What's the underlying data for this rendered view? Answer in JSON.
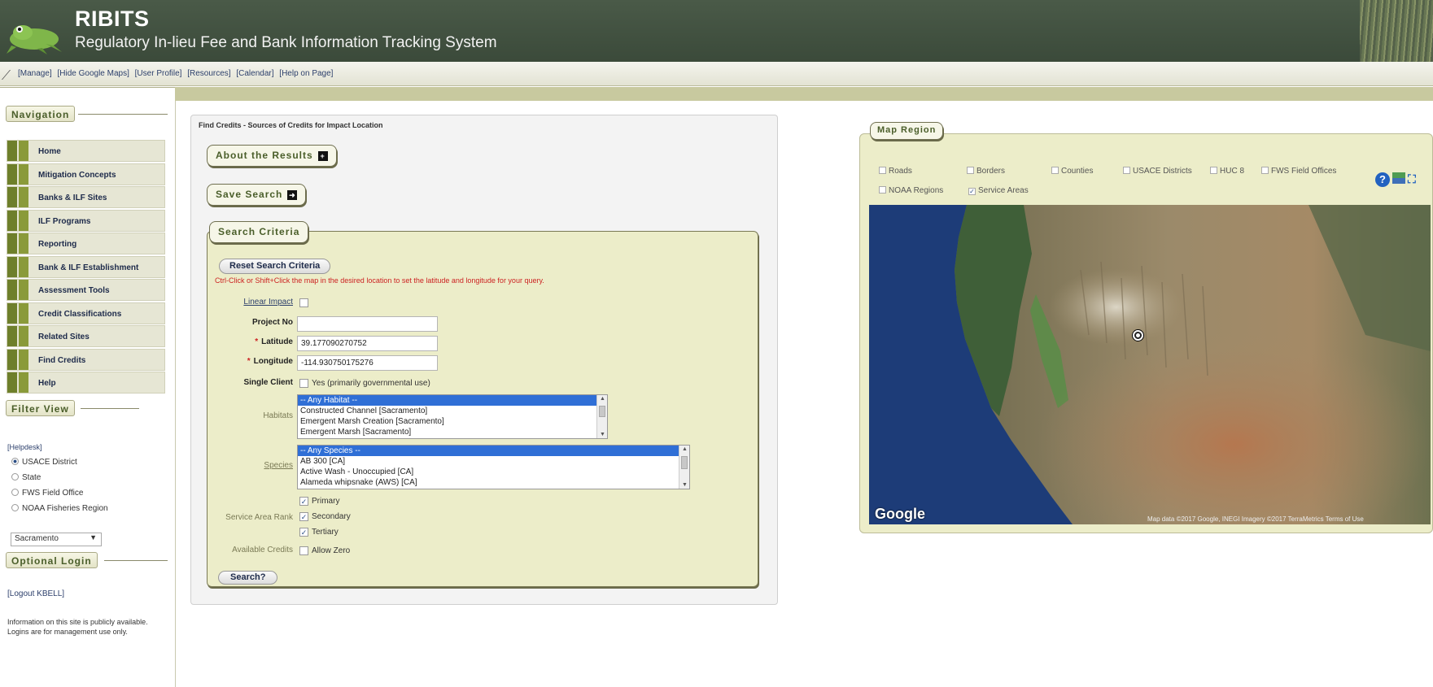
{
  "header": {
    "title": "RIBITS",
    "subtitle": "Regulatory In-lieu Fee and Bank Information Tracking System"
  },
  "menubar": {
    "links": [
      "[Manage]",
      "[Hide Google Maps]",
      "[User Profile]",
      "[Resources]",
      "[Calendar]",
      "[Help on Page]"
    ]
  },
  "sidebar": {
    "navigation_title": "Navigation",
    "items": [
      {
        "label": "Home"
      },
      {
        "label": "Mitigation Concepts"
      },
      {
        "label": "Banks & ILF Sites"
      },
      {
        "label": "ILF Programs"
      },
      {
        "label": "Reporting"
      },
      {
        "label": "Bank & ILF Establishment"
      },
      {
        "label": "Assessment Tools"
      },
      {
        "label": "Credit Classifications"
      },
      {
        "label": "Related Sites"
      },
      {
        "label": "Find Credits"
      },
      {
        "label": "Help"
      }
    ],
    "filter_title": "Filter View",
    "filter_help": "[Helpdesk]",
    "filter_options": [
      {
        "label": "USACE District",
        "selected": true
      },
      {
        "label": "State",
        "selected": false
      },
      {
        "label": "FWS Field Office",
        "selected": false
      },
      {
        "label": "NOAA Fisheries Region",
        "selected": false
      }
    ],
    "district_value": "Sacramento",
    "login_title": "Optional Login",
    "logout": "[Logout KBELL]",
    "info": "Information on this site is publicly available. Logins are for management use only."
  },
  "find_credits": {
    "panel_title": "Find Credits - Sources of Credits for Impact Location",
    "about_button": "About the Results",
    "save_button": "Save Search",
    "criteria_title": "Search Criteria",
    "reset_button": "Reset Search Criteria",
    "hint": "Ctrl-Click or Shift+Click the map in the desired location to set the latitude and longitude for your query.",
    "linear_impact_label": "Linear Impact",
    "project_label": "Project No",
    "project_value": "",
    "latitude_label": "Latitude",
    "latitude_value": "39.177090270752",
    "longitude_label": "Longitude",
    "longitude_value": "-114.930750175276",
    "single_client_label": "Single Client",
    "single_client_option": "Yes (primarily governmental use)",
    "habitats_label": "Habitats",
    "habitats": [
      "-- Any Habitat --",
      "Constructed Channel [Sacramento]",
      "Emergent Marsh Creation [Sacramento]",
      "Emergent Marsh [Sacramento]"
    ],
    "species_label": "Species",
    "species": [
      "-- Any Species --",
      "AB 300 [CA]",
      "Active Wash - Unoccupied [CA]",
      "Alameda whipsnake (AWS) [CA]"
    ],
    "service_rank_label": "Service Area Rank",
    "ranks": [
      {
        "label": "Primary",
        "checked": true
      },
      {
        "label": "Secondary",
        "checked": true
      },
      {
        "label": "Tertiary",
        "checked": true
      }
    ],
    "available_credits_label": "Available Credits",
    "allow_zero_label": "Allow Zero",
    "search_button": "Search?"
  },
  "map": {
    "title": "Map Region",
    "layers": [
      {
        "label": "Roads",
        "checked": false
      },
      {
        "label": "Borders",
        "checked": false
      },
      {
        "label": "Counties",
        "checked": false
      },
      {
        "label": "USACE Districts",
        "checked": false
      },
      {
        "label": "HUC 8",
        "checked": false
      },
      {
        "label": "FWS Field Offices",
        "checked": false
      },
      {
        "label": "NOAA Regions",
        "checked": false
      },
      {
        "label": "Service Areas",
        "checked": true
      }
    ],
    "google_label": "Google",
    "attribution": "Map data ©2017 Google, INEGI   Imagery ©2017 TerraMetrics   Terms of Use",
    "icons": [
      "help-icon",
      "legend-icon",
      "expand-icon"
    ]
  }
}
